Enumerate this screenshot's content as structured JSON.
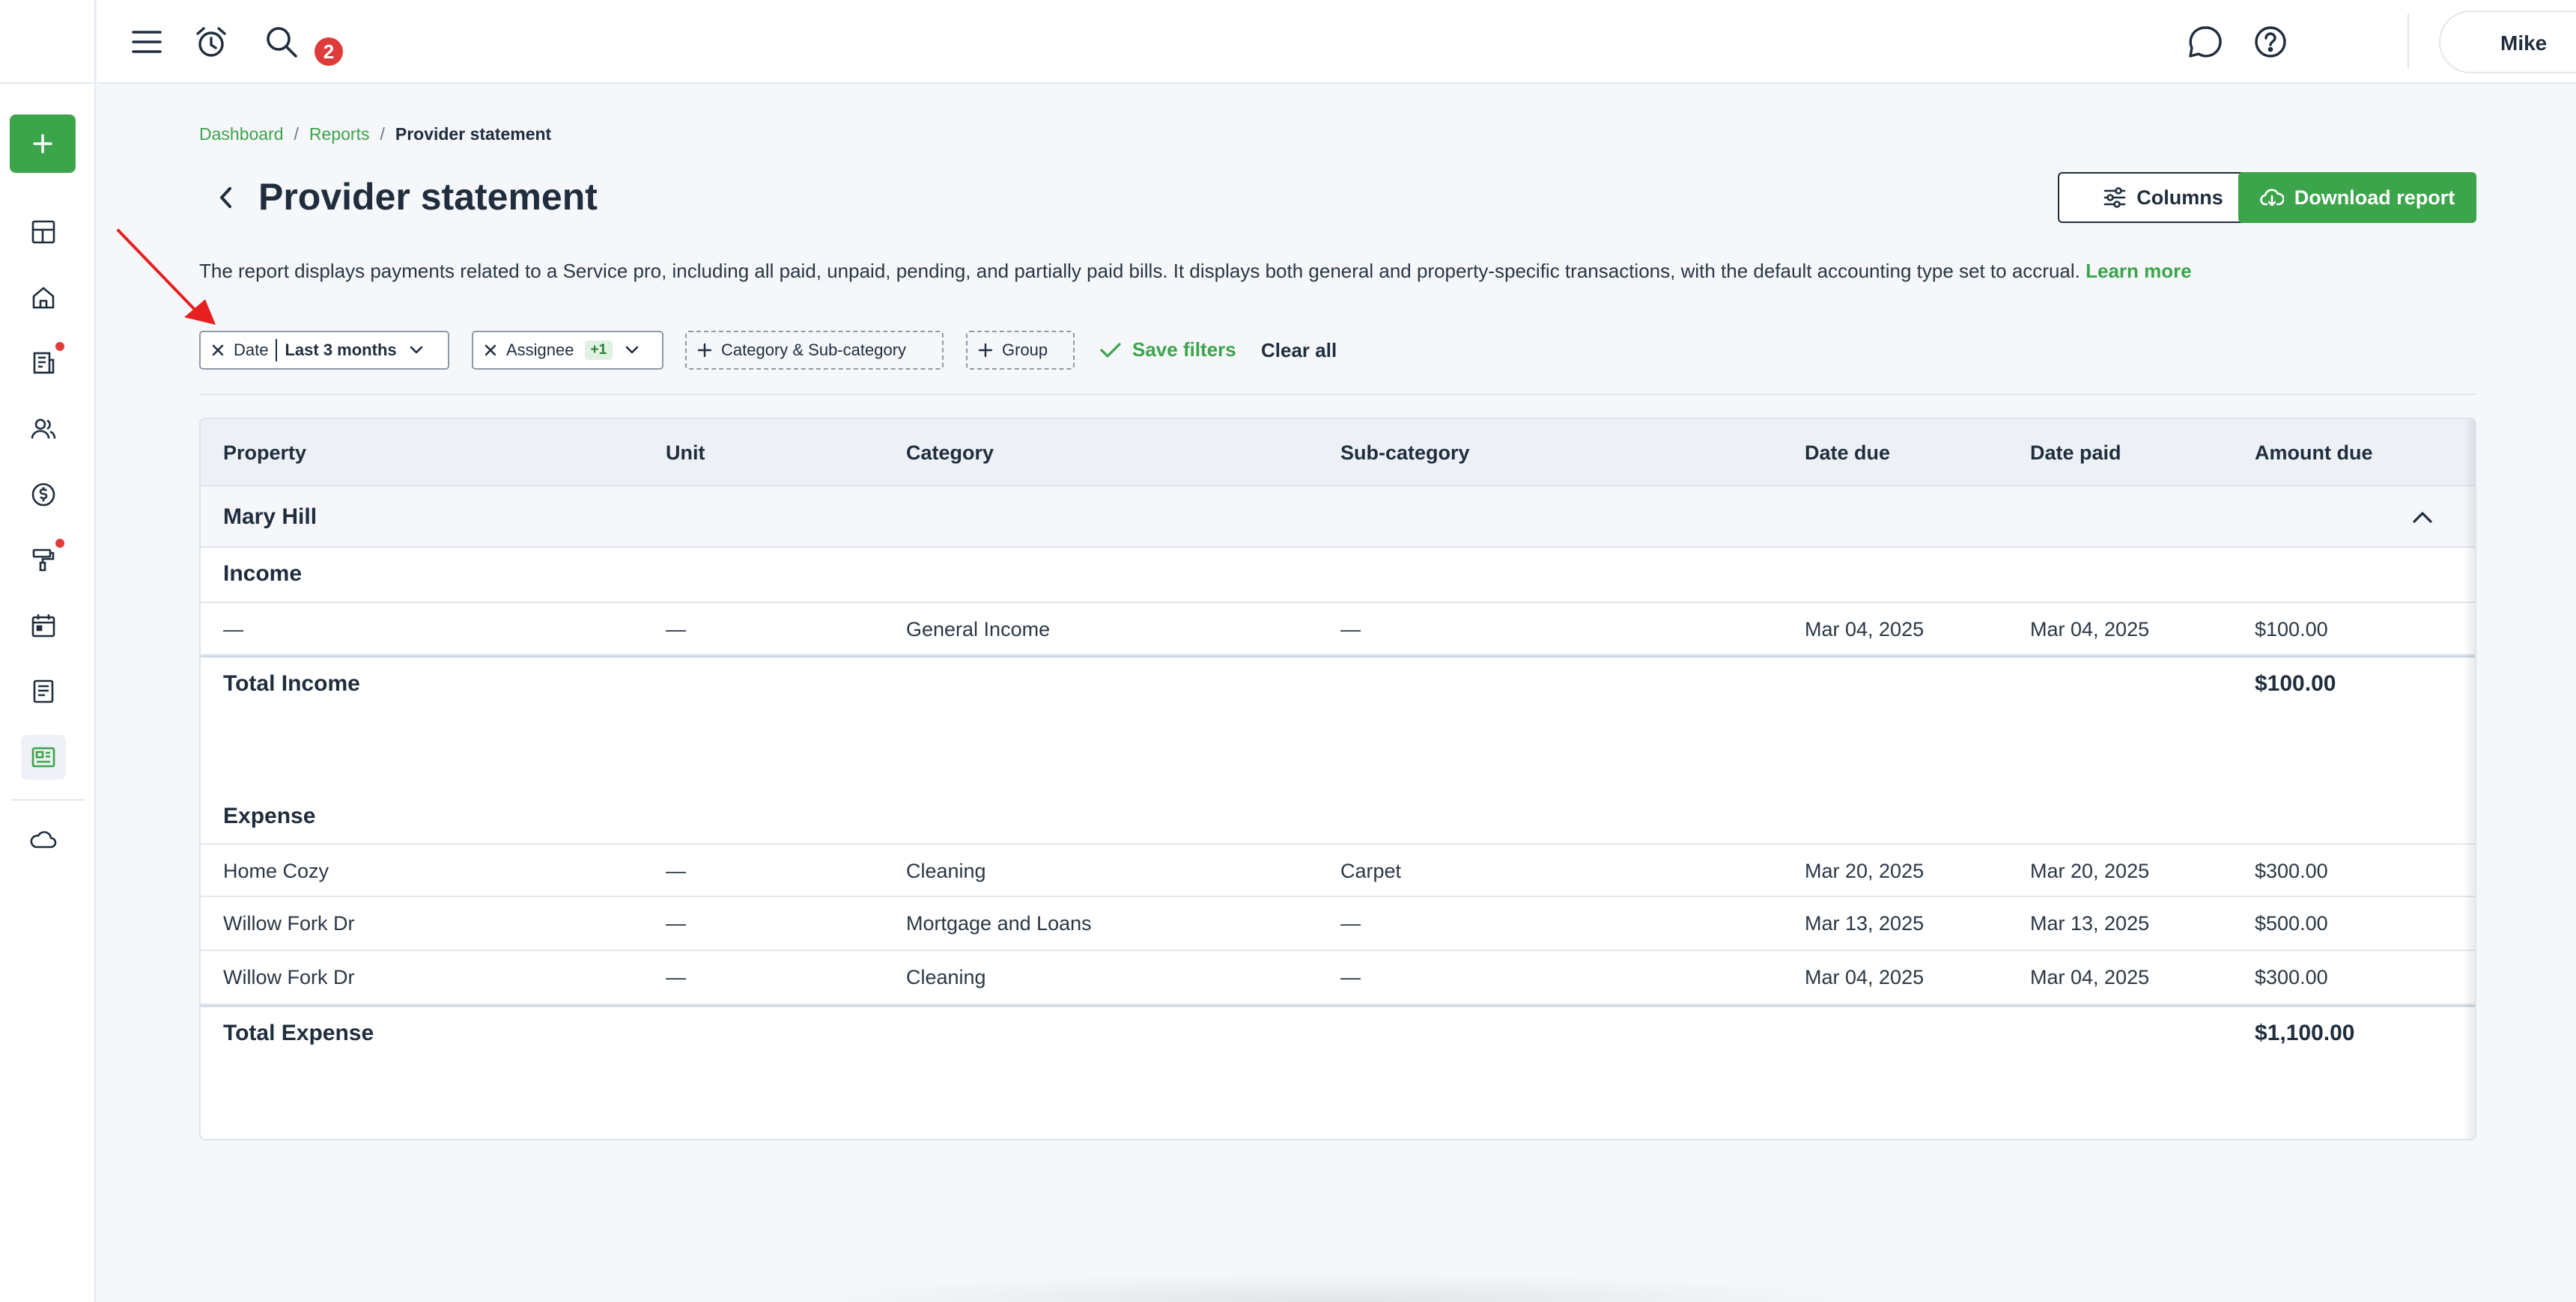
{
  "topbar": {
    "notification_count": "2",
    "user_name": "Mike"
  },
  "breadcrumb": {
    "items": [
      "Dashboard",
      "Reports"
    ],
    "current": "Provider statement"
  },
  "page": {
    "title": "Provider statement",
    "description": "The report displays payments related to a Service pro, including all paid, unpaid, pending, and partially paid bills. It displays both general and property-specific transactions, with the default accounting type set to accrual.",
    "learn_more": "Learn more"
  },
  "actions": {
    "columns_label": "Columns",
    "download_label": "Download report"
  },
  "filters": {
    "date_label": "Date",
    "date_value": "Last 3 months",
    "assignee_label": "Assignee",
    "assignee_extra": "+1",
    "category_label": "Category & Sub-category",
    "group_label": "Group",
    "save_label": "Save filters",
    "clear_label": "Clear all"
  },
  "table": {
    "columns": [
      "Property",
      "Unit",
      "Category",
      "Sub-category",
      "Date due",
      "Date paid",
      "Amount due"
    ],
    "group": "Mary Hill",
    "income": {
      "title": "Income",
      "rows": [
        [
          "—",
          "—",
          "General Income",
          "—",
          "Mar 04, 2025",
          "Mar 04, 2025",
          "$100.00"
        ]
      ],
      "total_label": "Total Income",
      "total_amount": "$100.00"
    },
    "expense": {
      "title": "Expense",
      "rows": [
        [
          "Home Cozy",
          "—",
          "Cleaning",
          "Carpet",
          "Mar 20, 2025",
          "Mar 20, 2025",
          "$300.00"
        ],
        [
          "Willow Fork Dr",
          "—",
          "Mortgage and Loans",
          "—",
          "Mar 13, 2025",
          "Mar 13, 2025",
          "$500.00"
        ],
        [
          "Willow Fork Dr",
          "—",
          "Cleaning",
          "—",
          "Mar 04, 2025",
          "Mar 04, 2025",
          "$300.00"
        ]
      ],
      "total_label": "Total Expense",
      "total_amount": "$1,100.00"
    }
  },
  "icons": {
    "menu": "hamburger-icon",
    "alarm": "alarm-clock-icon",
    "search": "search-icon",
    "chat": "chat-bubble-icon",
    "help": "question-circle-icon"
  },
  "colors": {
    "brand_green": "#3ca44a",
    "badge_red": "#e03b3b",
    "text_dark": "#1f2d3d"
  }
}
